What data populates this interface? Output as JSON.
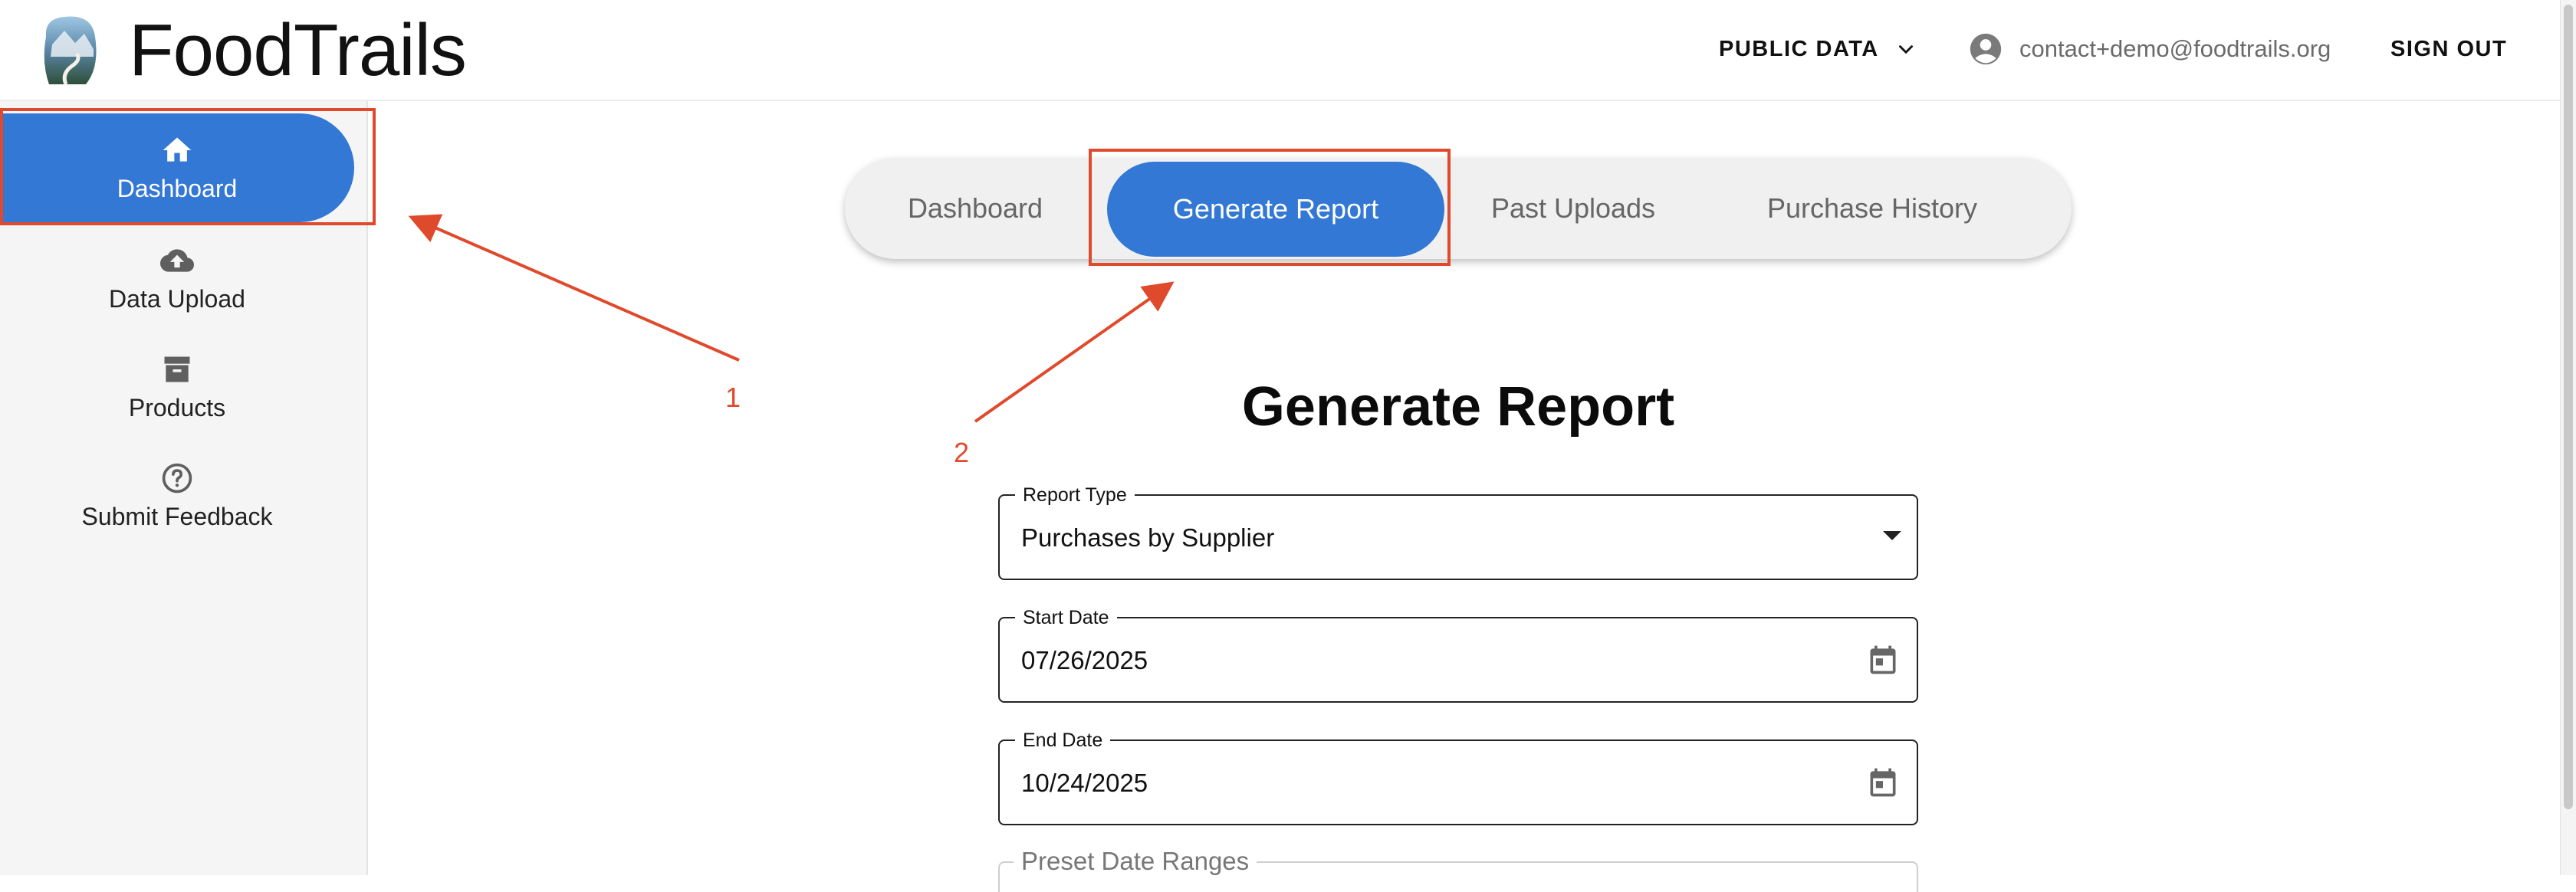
{
  "app": {
    "title": "FoodTrails"
  },
  "header": {
    "public_data_label": "PUBLIC DATA",
    "user_email": "contact+demo@foodtrails.org",
    "sign_out_label": "SIGN OUT"
  },
  "sidebar": {
    "items": [
      {
        "label": "Dashboard",
        "icon": "home-icon",
        "active": true
      },
      {
        "label": "Data Upload",
        "icon": "cloud-upload-icon",
        "active": false
      },
      {
        "label": "Products",
        "icon": "archive-box-icon",
        "active": false
      },
      {
        "label": "Submit Feedback",
        "icon": "help-circle-icon",
        "active": false
      }
    ]
  },
  "tabs": [
    {
      "label": "Dashboard",
      "active": false
    },
    {
      "label": "Generate Report",
      "active": true
    },
    {
      "label": "Past Uploads",
      "active": false
    },
    {
      "label": "Purchase History",
      "active": false
    }
  ],
  "main": {
    "title": "Generate Report",
    "report_type": {
      "label": "Report Type",
      "value": "Purchases by Supplier"
    },
    "start_date": {
      "label": "Start Date",
      "value": "07/26/2025"
    },
    "end_date": {
      "label": "End Date",
      "value": "10/24/2025"
    },
    "preset_ranges": {
      "label": "Preset Date Ranges"
    }
  },
  "annotations": {
    "step1": "1",
    "step2": "2",
    "color": "#e04a2c"
  },
  "colors": {
    "accent": "#3378d4",
    "sidebar_bg": "#f5f5f5"
  }
}
